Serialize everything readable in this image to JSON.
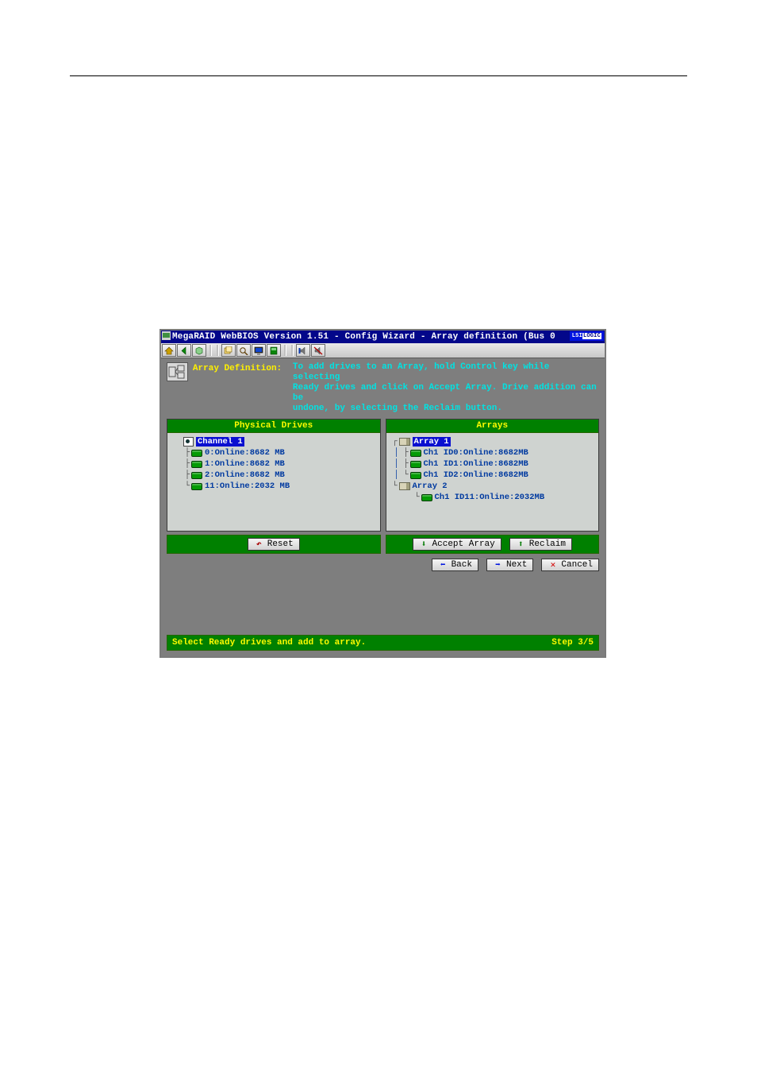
{
  "titlebar": {
    "title": "MegaRAID WebBIOS Version 1.51 - Config Wizard - Array definition (Bus 0",
    "logo": "LSI LOGIC"
  },
  "toolbar": {
    "icons": [
      "home",
      "back",
      "hex",
      "copy",
      "zoom",
      "monitor",
      "lock",
      "sound",
      "speaker"
    ]
  },
  "definition": {
    "title": "Array Definition:",
    "help1": "To add drives to an Array, hold Control key while selecting",
    "help2": "Ready drives and click on Accept Array. Drive addition can be",
    "help3": "undone, by selecting the Reclaim button."
  },
  "panels": {
    "left": {
      "header": "Physical Drives",
      "channel": "Channel 1",
      "items": [
        "0:Online:8682 MB",
        "1:Online:8682 MB",
        "2:Online:8682 MB",
        "11:Online:2032 MB"
      ]
    },
    "right": {
      "header": "Arrays",
      "arrays": [
        {
          "name": "Array 1",
          "items": [
            "Ch1 ID0:Online:8682MB",
            "Ch1 ID1:Online:8682MB",
            "Ch1 ID2:Online:8682MB"
          ]
        },
        {
          "name": "Array 2",
          "items": [
            "Ch1 ID11:Online:2032MB"
          ]
        }
      ]
    }
  },
  "buttons": {
    "reset": "Reset",
    "accept": "Accept Array",
    "reclaim": "Reclaim",
    "back": "Back",
    "next": "Next",
    "cancel": "Cancel"
  },
  "status": {
    "text": "Select Ready drives and add to array.",
    "step": "Step 3/5"
  }
}
